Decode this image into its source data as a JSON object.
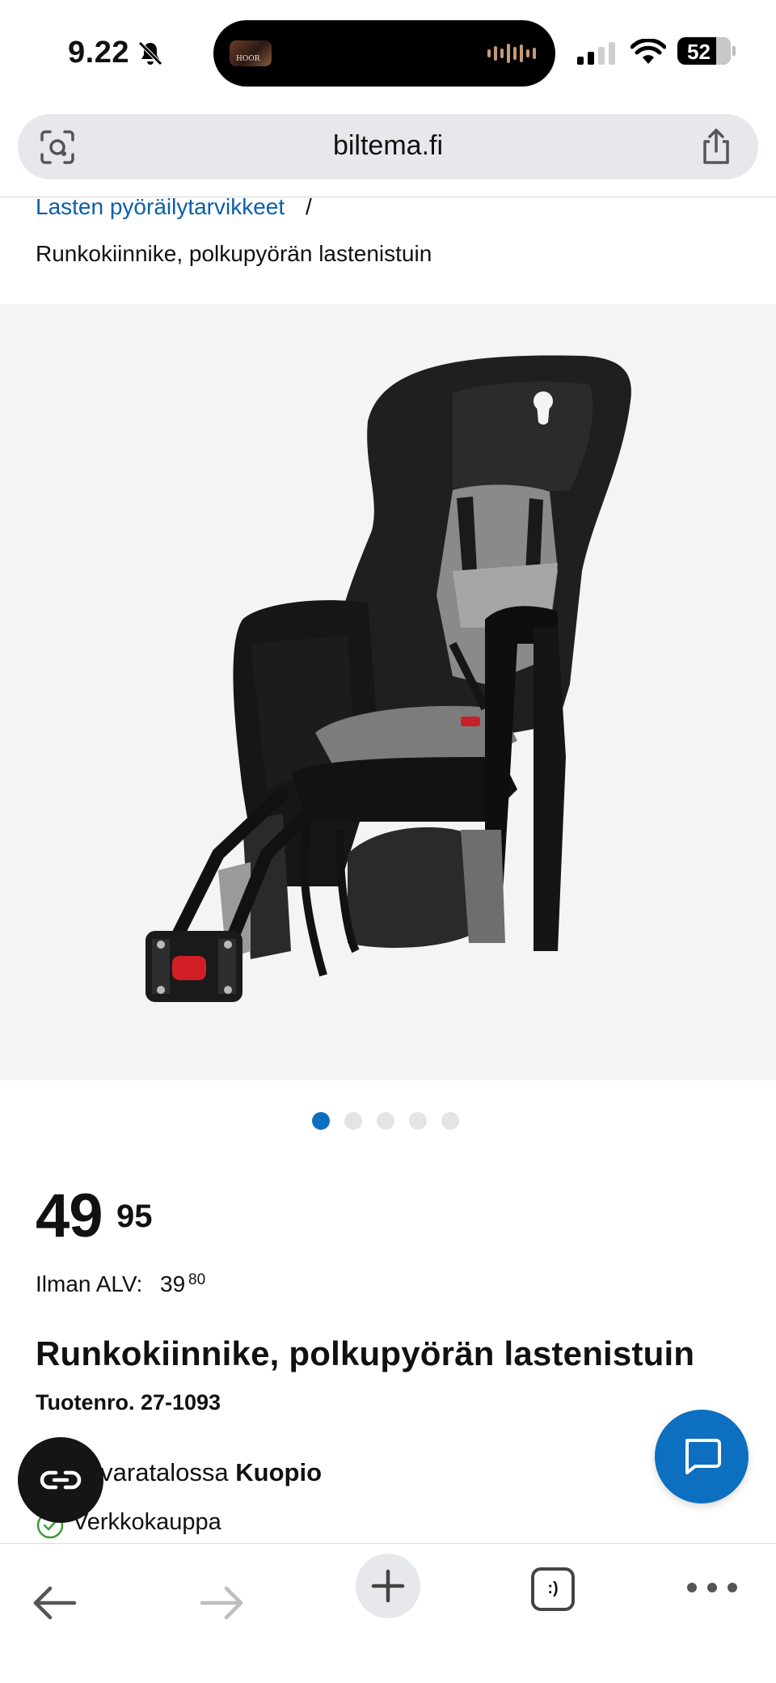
{
  "status_bar": {
    "time": "9.22",
    "battery": "52",
    "island_thumb_label": "HOOR"
  },
  "browser": {
    "url": "biltema.fi"
  },
  "breadcrumb": {
    "parent": "Lasten pyöräilytarvikkeet",
    "separator": "/",
    "current": "Runkokiinnike, polkupyörän lastenistuin"
  },
  "gallery": {
    "image_count": 5,
    "active_index": 0,
    "colors": {
      "active_dot": "#0b6fbf",
      "inactive_dot": "#e4e4e4"
    }
  },
  "product": {
    "price_whole": "49",
    "price_cents": "95",
    "vat_label": "Ilman ALV:",
    "vat_price_whole": "39",
    "vat_price_cents": "80",
    "title": "Runkokiinnike, polkupyörän lastenistuin",
    "sku": "Tuotenro. 27-1093",
    "stock_prefix": "0+) tavaratalossa ",
    "stock_store": "Kuopio",
    "online_label": "Verkkokauppa"
  },
  "icons": {
    "lens": "lens-icon",
    "share": "share-icon",
    "chat": "chat-bubble-icon",
    "copilot": "copilot-icon",
    "back": "arrow-left-icon",
    "forward": "arrow-right-icon",
    "new_tab": "plus-icon",
    "tabs": "tabs-icon",
    "more": "more-icon"
  },
  "toolbar": {
    "tabs_label": ":)"
  },
  "colors": {
    "link": "#0b5fa8",
    "chat_button": "#0d6fbf",
    "check_green": "#3a9b3a"
  }
}
